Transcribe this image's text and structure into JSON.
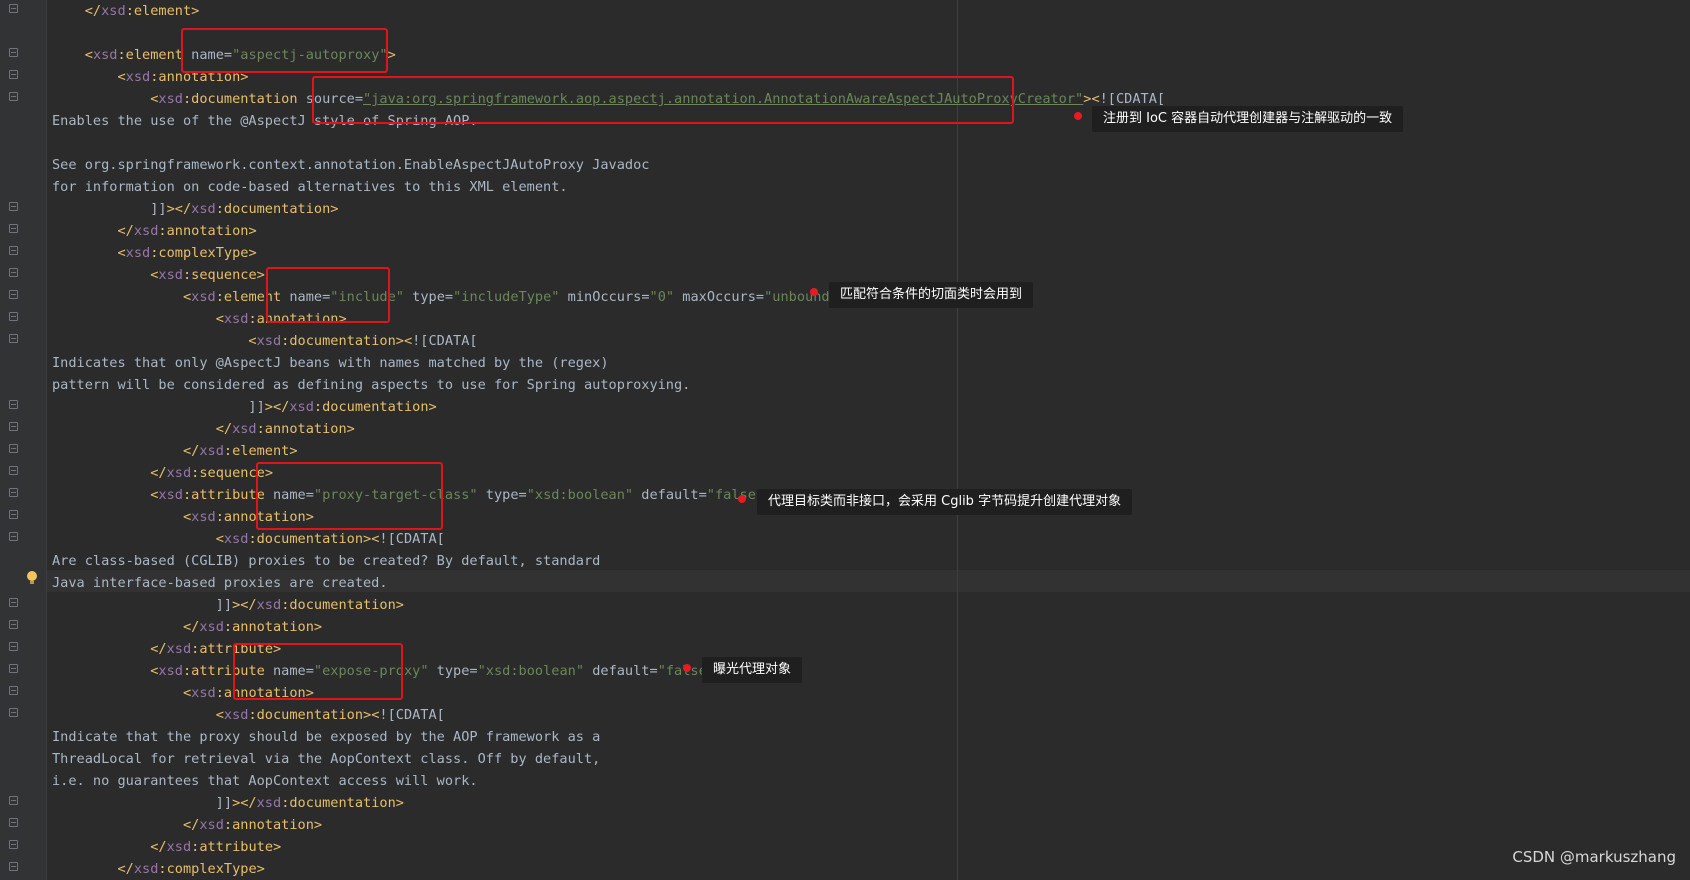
{
  "code_lines": [
    "    </xsd:element>",
    "",
    "    <xsd:element name=\"aspectj-autoproxy\">",
    "        <xsd:annotation>",
    "            <xsd:documentation source=\"java:org.springframework.aop.aspectj.annotation.AnnotationAwareAspectJAutoProxyCreator\"><![CDATA[",
    "Enables the use of the @AspectJ style of Spring AOP.",
    "",
    "See org.springframework.context.annotation.EnableAspectJAutoProxy Javadoc",
    "for information on code-based alternatives to this XML element.",
    "            ]]></xsd:documentation>",
    "        </xsd:annotation>",
    "        <xsd:complexType>",
    "            <xsd:sequence>",
    "                <xsd:element name=\"include\" type=\"includeType\" minOccurs=\"0\" maxOccurs=\"unbounded\">",
    "                    <xsd:annotation>",
    "                        <xsd:documentation><![CDATA[",
    "Indicates that only @AspectJ beans with names matched by the (regex)",
    "pattern will be considered as defining aspects to use for Spring autoproxying.",
    "                        ]]></xsd:documentation>",
    "                    </xsd:annotation>",
    "                </xsd:element>",
    "            </xsd:sequence>",
    "            <xsd:attribute name=\"proxy-target-class\" type=\"xsd:boolean\" default=\"false\">",
    "                <xsd:annotation>",
    "                    <xsd:documentation><![CDATA[",
    "Are class-based (CGLIB) proxies to be created? By default, standard",
    "Java interface-based proxies are created.",
    "                    ]]></xsd:documentation>",
    "                </xsd:annotation>",
    "            </xsd:attribute>",
    "            <xsd:attribute name=\"expose-proxy\" type=\"xsd:boolean\" default=\"false\">",
    "                <xsd:annotation>",
    "                    <xsd:documentation><![CDATA[",
    "Indicate that the proxy should be exposed by the AOP framework as a",
    "ThreadLocal for retrieval via the AopContext class. Off by default,",
    "i.e. no guarantees that AopContext access will work.",
    "                    ]]></xsd:documentation>",
    "                </xsd:annotation>",
    "            </xsd:attribute>",
    "        </xsd:complexType>"
  ],
  "annotations": [
    "注册到 IoC 容器自动代理创建器与注解驱动的一致",
    "匹配符合条件的切面类时会用到",
    "代理目标类而非接口，会采用 Cglib 字节码提升创建代理对象",
    "曝光代理对象"
  ],
  "watermark": "CSDN @markuszhang",
  "colors": {
    "editor_background": "#2b2b2b",
    "tag": "#e8bf6a",
    "namespace": "#9876aa",
    "attribute_value": "#6a8759",
    "plain_text": "#a9b7c6",
    "highlight_box": "#e2141b",
    "note_background": "#1f1f1f"
  }
}
